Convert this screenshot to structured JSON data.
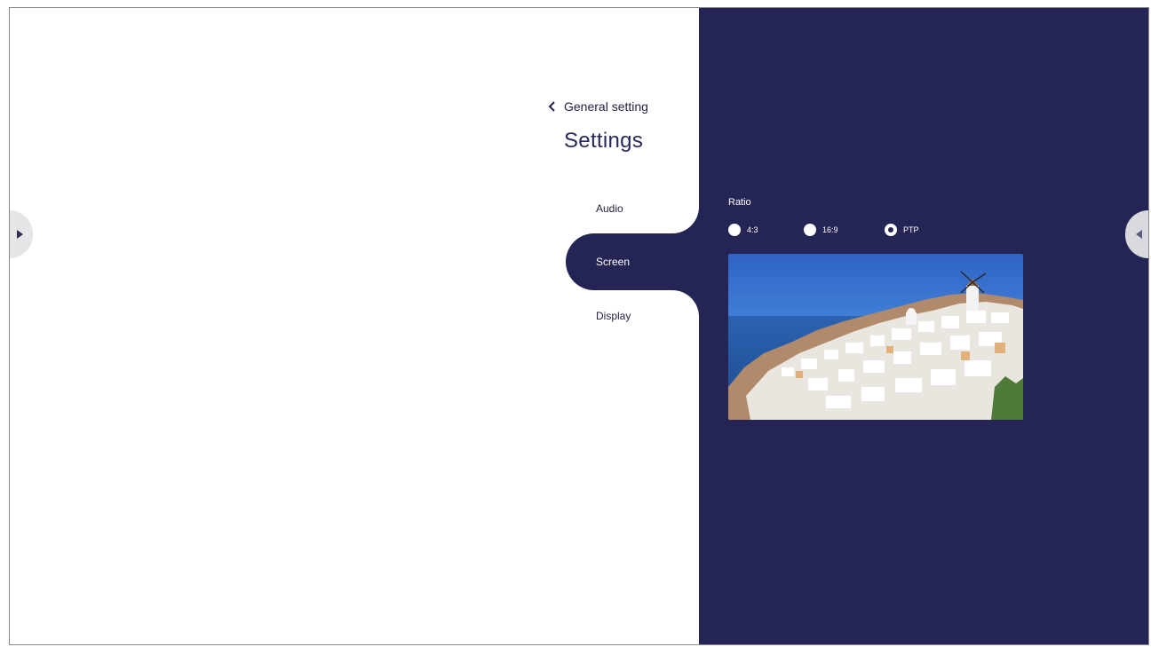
{
  "header": {
    "back_label": "General setting",
    "title": "Settings"
  },
  "menu": {
    "items": [
      {
        "label": "Audio"
      },
      {
        "label": "Screen"
      },
      {
        "label": "Display"
      }
    ],
    "active": "Screen"
  },
  "ratio": {
    "label": "Ratio",
    "options": [
      {
        "label": "4:3",
        "selected": false
      },
      {
        "label": "16:9",
        "selected": false
      },
      {
        "label": "PTP",
        "selected": true
      }
    ]
  },
  "preview": {
    "icon": "santorini-landscape-image"
  },
  "colors": {
    "panel_bg": "#242554",
    "page_bg": "#ffffff",
    "text_dark": "#26285a"
  },
  "icons": {
    "back": "chevron-left-icon",
    "left_tab": "play-arrow-icon",
    "right_tab": "caret-left-icon"
  }
}
